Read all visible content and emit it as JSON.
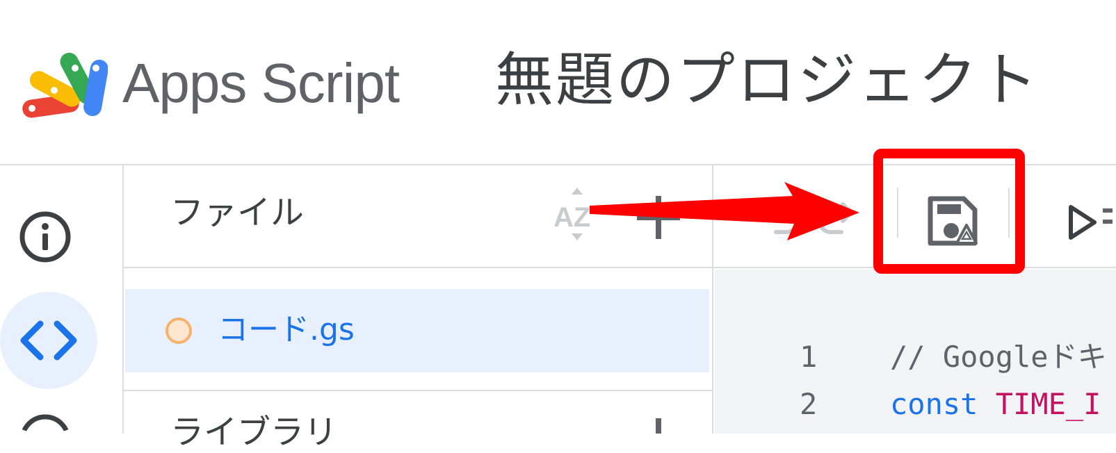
{
  "header": {
    "app_name": "Apps Script",
    "project_title": "無題のプロジェクト"
  },
  "left_rail": {
    "items": [
      {
        "icon": "info-icon"
      },
      {
        "icon": "code-icon",
        "active": true
      },
      {
        "icon": "history-icon"
      }
    ]
  },
  "files_panel": {
    "title": "ファイル",
    "sort_icon": "sort-az-icon",
    "add_icon": "add-icon",
    "files": [
      {
        "name": "コード.gs",
        "status_color": "#f6b26b",
        "selected": true
      }
    ],
    "libraries_label": "ライブラリ"
  },
  "toolbar": {
    "items": [
      {
        "icon": "undo-icon"
      },
      {
        "icon": "redo-icon"
      },
      {
        "icon": "save-to-drive-icon",
        "highlighted": true
      },
      {
        "icon": "run-icon"
      }
    ],
    "highlight_color": "#ff0000"
  },
  "editor": {
    "lines": [
      {
        "number": "1",
        "text": "// Googleドキ"
      },
      {
        "number": "2",
        "keyword": "const",
        "identifier": "TIME_I"
      }
    ],
    "colors": {
      "comment": "#5f6368",
      "keyword": "#1a73e8",
      "identifier": "#c51162"
    }
  },
  "colors": {
    "selected_bg": "#e8f0fe",
    "accent": "#1a73e8",
    "border": "#dadce0",
    "editor_bg": "#f1f3f4"
  }
}
